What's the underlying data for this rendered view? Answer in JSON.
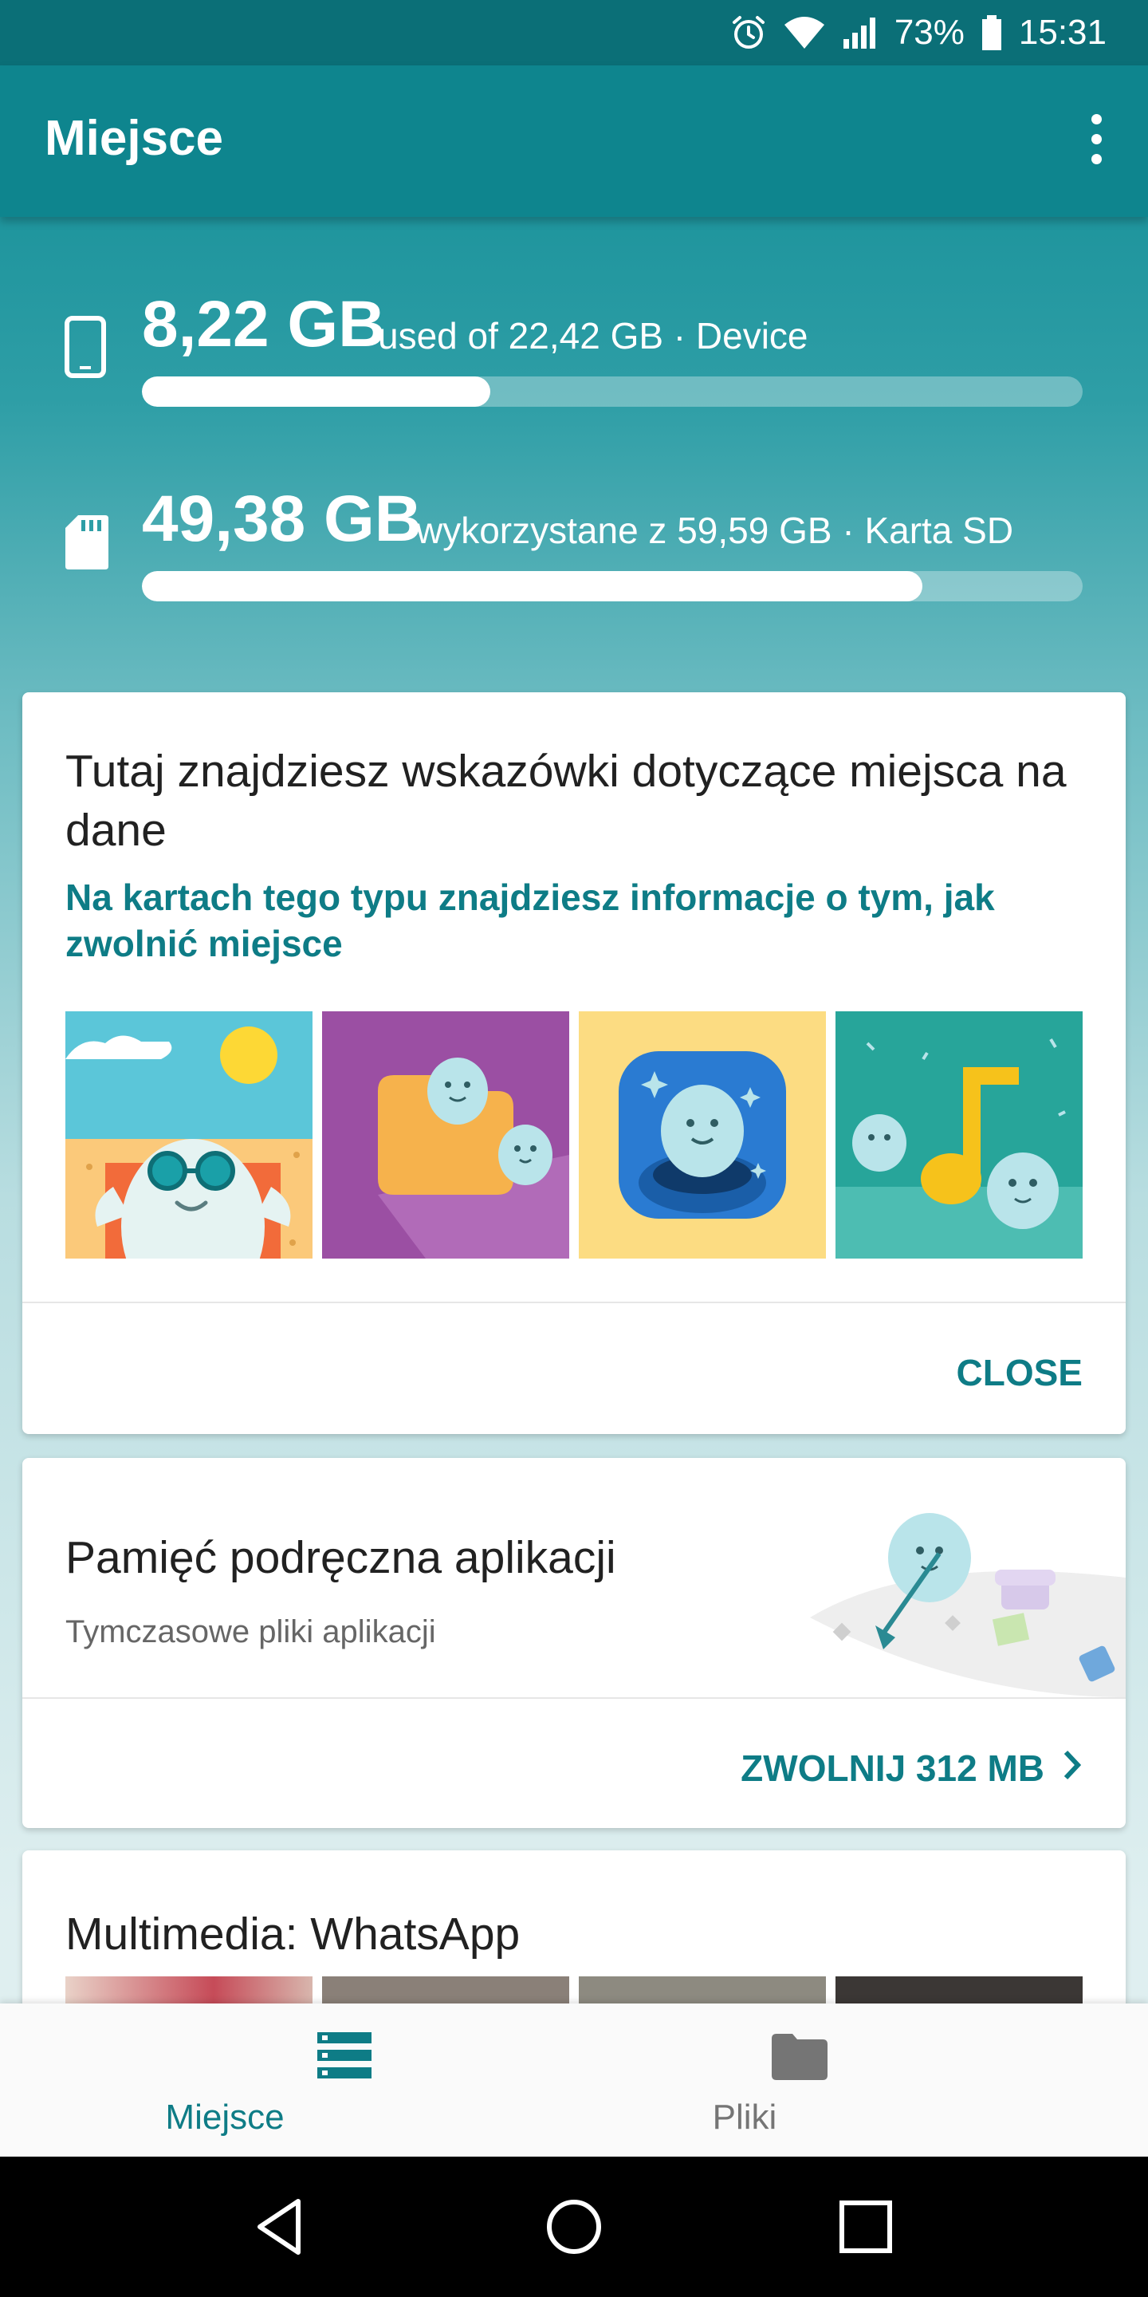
{
  "status_bar": {
    "battery": "73%",
    "time": "15:31",
    "icons": [
      "alarm-icon",
      "wifi-icon",
      "signal-icon",
      "battery-icon"
    ]
  },
  "app_bar": {
    "title": "Miejsce",
    "menu_icon": "more-vert-icon"
  },
  "storage": [
    {
      "icon": "phone-icon",
      "amount": "8,22 GB",
      "detail": "used of 22,42 GB · Device",
      "used_fraction": 0.37
    },
    {
      "icon": "sd-card-icon",
      "amount": "49,38 GB",
      "detail": "wykorzystane z 59,59 GB · Karta SD",
      "used_fraction": 0.83
    }
  ],
  "tips_card": {
    "title": "Tutaj znajdziesz wskazówki dotyczące miejsca na dane",
    "subtitle": "Na kartach tego typu znajdziesz informacje o tym, jak zwolnić miejsce",
    "action": "CLOSE"
  },
  "cache_card": {
    "title": "Pamięć podręczna aplikacji",
    "subtitle": "Tymczasowe pliki aplikacji",
    "action": "ZWOLNIJ 312 MB"
  },
  "media_card": {
    "title": "Multimedia: WhatsApp"
  },
  "bottom_nav": {
    "items": [
      {
        "label": "Miejsce",
        "icon": "storage-list-icon",
        "active": true
      },
      {
        "label": "Pliki",
        "icon": "folder-icon",
        "active": false
      }
    ]
  },
  "colors": {
    "accent": "#0e7c86",
    "app_bar": "#0e858e",
    "status_bar": "#0b6f77"
  }
}
